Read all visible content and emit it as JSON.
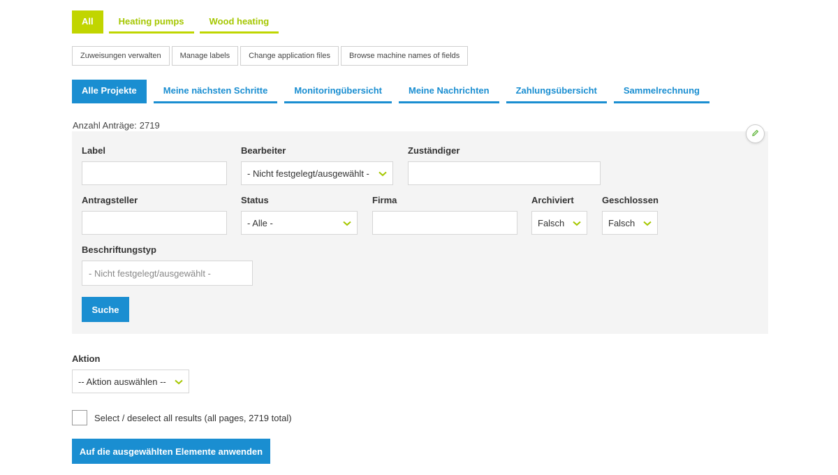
{
  "category_tabs": [
    "All",
    "Heating pumps",
    "Wood heating"
  ],
  "admin_buttons": [
    "Zuweisungen verwalten",
    "Manage labels",
    "Change application files",
    "Browse machine names of fields"
  ],
  "project_tabs": [
    "Alle Projekte",
    "Meine nächsten Schritte",
    "Monitoringübersicht",
    "Meine Nachrichten",
    "Zahlungsübersicht",
    "Sammelrechnung"
  ],
  "count": {
    "label": "Anzahl Anträge:",
    "value": "2719"
  },
  "filters": {
    "label_field": {
      "label": "Label",
      "value": ""
    },
    "bearbeiter": {
      "label": "Bearbeiter",
      "value": "- Nicht festgelegt/ausgewählt -"
    },
    "zustaendiger": {
      "label": "Zuständiger",
      "value": ""
    },
    "antragsteller": {
      "label": "Antragsteller",
      "value": ""
    },
    "status": {
      "label": "Status",
      "value": "- Alle -"
    },
    "firma": {
      "label": "Firma",
      "value": ""
    },
    "archiviert": {
      "label": "Archiviert",
      "value": "Falsch"
    },
    "geschlossen": {
      "label": "Geschlossen",
      "value": "Falsch"
    },
    "beschriftungstyp": {
      "label": "Beschriftungstyp",
      "placeholder": "- Nicht festgelegt/ausgewählt -"
    },
    "search_button": "Suche"
  },
  "aktion": {
    "label": "Aktion",
    "value": "-- Aktion auswählen --"
  },
  "select_all_label": "Select / deselect all results (all pages, 2719 total)",
  "apply_button": "Auf die ausgewählten Elemente anwenden",
  "colors": {
    "green": "#c1d500",
    "blue": "#1a8ed1",
    "panel": "#f4f4f4"
  },
  "icons": {
    "edit": "pencil-icon",
    "dropdown": "chevron-down-icon"
  }
}
